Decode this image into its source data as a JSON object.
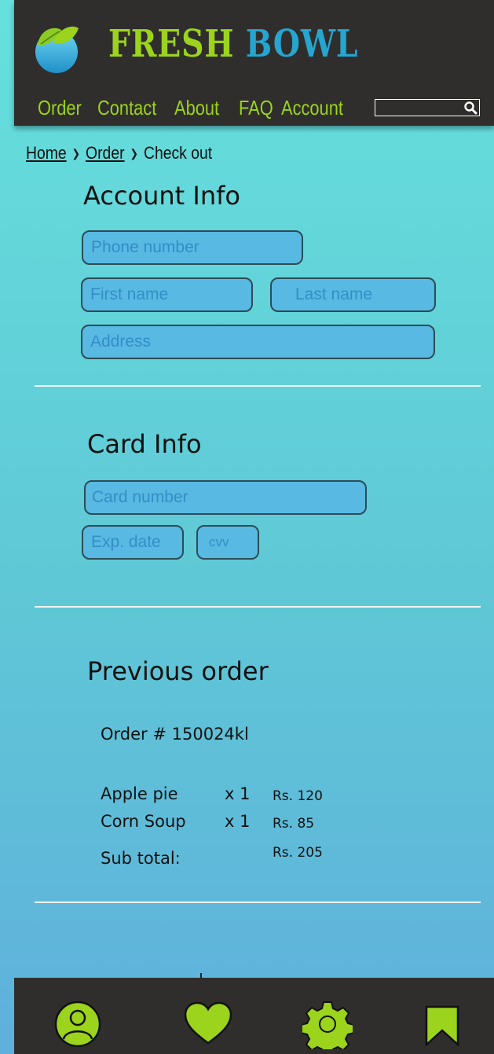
{
  "brand": {
    "word1": "FRESH",
    "word2": "BOWL"
  },
  "colors": {
    "accent_green": "#9bd31d",
    "accent_blue": "#26a5cf",
    "dark": "#2f2e2c",
    "field_bg": "#58b9e2"
  },
  "nav": {
    "items": [
      "Order",
      "Contact",
      "About",
      "FAQ",
      "Account"
    ]
  },
  "search": {
    "placeholder": ""
  },
  "breadcrumb": {
    "home": "Home",
    "order": "Order",
    "current": "Check out"
  },
  "account_info": {
    "title": "Account Info",
    "phone_placeholder": "Phone number",
    "first_name_placeholder": "First name",
    "last_name_placeholder": "Last name",
    "address_placeholder": "Address"
  },
  "card_info": {
    "title": "Card Info",
    "card_number_placeholder": "Card number",
    "exp_placeholder": "Exp. date",
    "cvv_placeholder": "cvv"
  },
  "previous_order": {
    "title": "Previous order",
    "order_number": "Order  # 150024kl",
    "items": [
      {
        "name": "Apple pie",
        "qty": "x 1",
        "price": "Rs. 120"
      },
      {
        "name": "Corn Soup",
        "qty": "x 1",
        "price": "Rs. 85"
      }
    ],
    "subtotal_label": "Sub total:",
    "subtotal_value": "Rs. 205"
  },
  "bottom_tabs": [
    "profile-icon",
    "heart-icon",
    "gear-icon",
    "bookmark-icon"
  ]
}
